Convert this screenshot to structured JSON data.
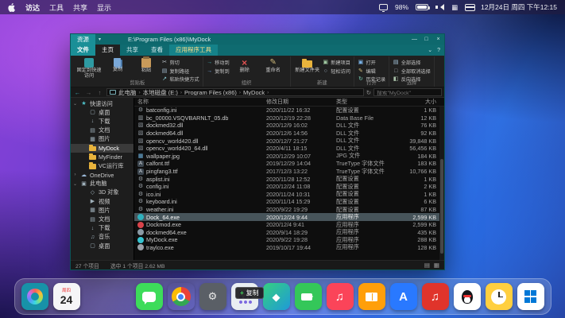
{
  "colors": {
    "accent": "#0f6b70",
    "titlebar": "#0e686d",
    "tab_active": "#1a8f97",
    "selection": "#47545a"
  },
  "menubar": {
    "items": [
      "访达",
      "工具",
      "共享",
      "显示"
    ],
    "battery": "98%",
    "datetime": "12月24日 周四 下午12:15"
  },
  "window": {
    "tab": "资源",
    "title": "E:\\Program Files (x86)\\MyDock",
    "controls": {
      "min": "—",
      "max": "□",
      "close": "×"
    },
    "ribbon_tabs": [
      {
        "label": "文件",
        "kind": "file"
      },
      {
        "label": "主页",
        "kind": "active"
      },
      {
        "label": "共享",
        "kind": "plain"
      },
      {
        "label": "查看",
        "kind": "plain"
      },
      {
        "label": "应用程序工具",
        "kind": "context"
      }
    ],
    "ribbon_collapse": "⌄",
    "ribbon_help": "?",
    "ribbon_groups": [
      {
        "label": "剪贴板",
        "cols": [
          {
            "type": "big",
            "items": [
              {
                "label": "固定到快速访问",
                "icon": "pin"
              }
            ]
          },
          {
            "type": "big",
            "items": [
              {
                "label": "复制",
                "icon": "copy"
              }
            ]
          },
          {
            "type": "big",
            "items": [
              {
                "label": "粘贴",
                "icon": "paste"
              }
            ]
          },
          {
            "type": "stack",
            "items": [
              {
                "label": "剪切",
                "icon": "cut"
              },
              {
                "label": "复制路径",
                "icon": "path"
              },
              {
                "label": "粘贴快捷方式",
                "icon": "shortcut"
              }
            ]
          }
        ]
      },
      {
        "label": "组织",
        "cols": [
          {
            "type": "stack",
            "items": [
              {
                "label": "移动到",
                "icon": "move"
              },
              {
                "label": "复制到",
                "icon": "copyto"
              }
            ]
          },
          {
            "type": "big",
            "items": [
              {
                "label": "删除",
                "icon": "delete"
              }
            ]
          },
          {
            "type": "big",
            "items": [
              {
                "label": "重命名",
                "icon": "rename"
              }
            ]
          }
        ]
      },
      {
        "label": "新建",
        "cols": [
          {
            "type": "big",
            "items": [
              {
                "label": "新建文件夹",
                "icon": "newfolder"
              }
            ]
          },
          {
            "type": "stack",
            "items": [
              {
                "label": "新建项目",
                "icon": "newitem"
              },
              {
                "label": "轻松访问",
                "icon": "access"
              }
            ]
          }
        ]
      },
      {
        "label": "打开",
        "cols": [
          {
            "type": "stack",
            "items": [
              {
                "label": "打开",
                "icon": "open"
              },
              {
                "label": "编辑",
                "icon": "edit"
              },
              {
                "label": "历史记录",
                "icon": "history"
              }
            ]
          }
        ]
      },
      {
        "label": "选择",
        "cols": [
          {
            "type": "stack",
            "items": [
              {
                "label": "全部选择",
                "icon": "selall"
              },
              {
                "label": "全部取消选择",
                "icon": "selnone"
              },
              {
                "label": "反向选择",
                "icon": "selinv"
              }
            ]
          }
        ]
      }
    ],
    "nav": {
      "back": "←",
      "forward": "→",
      "up": "↑",
      "refresh": "↻"
    },
    "breadcrumb": [
      "此电脑",
      "本地磁盘 (E:)",
      "Program Files (x86)",
      "MyDock"
    ],
    "search_placeholder": "搜索\"MyDock\"",
    "sidebar": [
      {
        "label": "快速访问",
        "icon": "star",
        "level": 0,
        "chevron": "⌄"
      },
      {
        "label": "桌面",
        "icon": "desktop",
        "level": 1
      },
      {
        "label": "下载",
        "icon": "download",
        "level": 1
      },
      {
        "label": "文档",
        "icon": "documents",
        "level": 1
      },
      {
        "label": "图片",
        "icon": "pictures",
        "level": 1
      },
      {
        "label": "MyDock",
        "icon": "folder",
        "level": 1,
        "selected": true
      },
      {
        "label": "MyFinder",
        "icon": "folder",
        "level": 1
      },
      {
        "label": "VC运行库",
        "icon": "folder",
        "level": 1
      },
      {
        "label": "OneDrive",
        "icon": "cloud",
        "level": 0,
        "chevron": "›"
      },
      {
        "label": "此电脑",
        "icon": "pc",
        "level": 0,
        "chevron": "⌄"
      },
      {
        "label": "3D 对象",
        "icon": "cube",
        "level": 1
      },
      {
        "label": "视频",
        "icon": "video",
        "level": 1
      },
      {
        "label": "图片",
        "icon": "pictures",
        "level": 1
      },
      {
        "label": "文档",
        "icon": "documents",
        "level": 1
      },
      {
        "label": "下载",
        "icon": "download",
        "level": 1
      },
      {
        "label": "音乐",
        "icon": "music",
        "level": 1
      },
      {
        "label": "桌面",
        "icon": "desktop",
        "level": 1
      }
    ],
    "columns": {
      "name": "名称",
      "date": "修改日期",
      "type": "类型",
      "size": "大小"
    },
    "files": [
      {
        "name": "batconfig.ini",
        "date": "2020/11/22 16:32",
        "type": "配置设置",
        "size": "1 KB",
        "icon": "ini"
      },
      {
        "name": "bc_00000.VSQVBARNLT_05.db",
        "date": "2020/12/19 22:28",
        "type": "Data Base File",
        "size": "12 KB",
        "icon": "db"
      },
      {
        "name": "dockmed32.dll",
        "date": "2020/12/9 16:02",
        "type": "DLL 文件",
        "size": "76 KB",
        "icon": "dll"
      },
      {
        "name": "dockmed64.dll",
        "date": "2020/12/6 14:56",
        "type": "DLL 文件",
        "size": "92 KB",
        "icon": "dll"
      },
      {
        "name": "opencv_world420.dll",
        "date": "2020/12/7 21:27",
        "type": "DLL 文件",
        "size": "39,848 KB",
        "icon": "dll"
      },
      {
        "name": "opencv_world420_64.dll",
        "date": "2020/4/11 18:15",
        "type": "DLL 文件",
        "size": "56,456 KB",
        "icon": "dll"
      },
      {
        "name": "wallpaper.jpg",
        "date": "2020/12/29 10:07",
        "type": "JPG 文件",
        "size": "184 KB",
        "icon": "jpg"
      },
      {
        "name": "calfont.ttf",
        "date": "2019/12/29 14:04",
        "type": "TrueType 字体文件",
        "size": "183 KB",
        "icon": "ttf"
      },
      {
        "name": "pingfang3.ttf",
        "date": "2017/12/3 13:22",
        "type": "TrueType 字体文件",
        "size": "10,766 KB",
        "icon": "ttf"
      },
      {
        "name": "asplist.ini",
        "date": "2020/11/28 12:52",
        "type": "配置设置",
        "size": "1 KB",
        "icon": "ini"
      },
      {
        "name": "config.ini",
        "date": "2020/12/24 11:08",
        "type": "配置设置",
        "size": "2 KB",
        "icon": "ini"
      },
      {
        "name": "ico.ini",
        "date": "2020/11/24 10:31",
        "type": "配置设置",
        "size": "1 KB",
        "icon": "ini"
      },
      {
        "name": "keyboard.ini",
        "date": "2020/11/14 15:29",
        "type": "配置设置",
        "size": "6 KB",
        "icon": "ini"
      },
      {
        "name": "weather.ini",
        "date": "2020/9/22 19:29",
        "type": "配置设置",
        "size": "87 KB",
        "icon": "ini"
      },
      {
        "name": "Dock_64.exe",
        "date": "2020/12/24 9:44",
        "type": "应用程序",
        "size": "2,599 KB",
        "icon": "exe",
        "color": "#2fb0bd",
        "selected": true
      },
      {
        "name": "Dockmod.exe",
        "date": "2020/12/4 9:41",
        "type": "应用程序",
        "size": "2,599 KB",
        "icon": "exe",
        "color": "#d8434a"
      },
      {
        "name": "dockmed64.exe",
        "date": "2020/9/14 18:29",
        "type": "应用程序",
        "size": "435 KB",
        "icon": "exe",
        "color": "#8a9aa5"
      },
      {
        "name": "MyDock.exe",
        "date": "2020/9/22 19:28",
        "type": "应用程序",
        "size": "288 KB",
        "icon": "exe",
        "color": "#35c3d0"
      },
      {
        "name": "traylco.exe",
        "date": "2019/10/17 19:44",
        "type": "应用程序",
        "size": "128 KB",
        "icon": "exe",
        "color": "#9aa0a8"
      }
    ],
    "statusbar": {
      "count": "27 个项目",
      "selection": "选中 1 个项目 2.62 MB"
    }
  },
  "dock": {
    "badge": {
      "plus": "+",
      "text": "复制"
    },
    "items": [
      {
        "name": "mydock-launcher",
        "kind": "ring",
        "bg": "#1792a8"
      },
      {
        "name": "calendar",
        "kind": "calendar",
        "weekday": "周四",
        "day": "24",
        "bg": "#f5f5f7"
      },
      {
        "name": "spacer",
        "kind": "spacer"
      },
      {
        "name": "messages",
        "kind": "bubble",
        "bg": "#3ddc5a"
      },
      {
        "name": "chrome",
        "kind": "chrome",
        "bg": "transparent"
      },
      {
        "name": "settings",
        "kind": "grid-dark",
        "bg": "#5a5f66"
      },
      {
        "name": "launchpad",
        "kind": "grid",
        "bg": "#e9eef2"
      },
      {
        "name": "maps",
        "kind": "shield",
        "bg": "linear-gradient(135deg,#35d07f,#1f9ad8)"
      },
      {
        "name": "facetime",
        "kind": "camera",
        "bg": "#34c759"
      },
      {
        "name": "music",
        "kind": "note",
        "bg": "#fb4459"
      },
      {
        "name": "books",
        "kind": "book",
        "bg": "#ff9f0a"
      },
      {
        "name": "app-store",
        "kind": "letter-a",
        "bg": "#2979ff"
      },
      {
        "name": "netease-music",
        "kind": "note",
        "bg": "#e0342b"
      },
      {
        "name": "qq",
        "kind": "qq",
        "bg": "#ffffff"
      },
      {
        "name": "clock",
        "kind": "clock",
        "bg": "#ffcf3f"
      },
      {
        "name": "windows-start",
        "kind": "windows",
        "bg": "#ffffff"
      }
    ]
  }
}
